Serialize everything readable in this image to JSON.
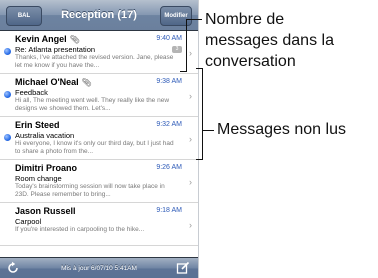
{
  "navbar": {
    "back_label": "BAL",
    "title": "Reception (17)",
    "edit_label": "Modifier"
  },
  "messages": [
    {
      "sender": "Kevin Angel",
      "has_attachment": true,
      "time": "9:40 AM",
      "subject": "Re: Atlanta presentation",
      "preview": "Thanks, I've attached the revised version. Jane, please let me know if you have the...",
      "unread": true,
      "count": "3"
    },
    {
      "sender": "Michael O'Neal",
      "has_attachment": true,
      "time": "9:38 AM",
      "subject": "Feedback",
      "preview": "Hi all, The meeting went well. They really like the new designs we showed them. Let's...",
      "unread": true,
      "count": ""
    },
    {
      "sender": "Erin Steed",
      "has_attachment": false,
      "time": "9:32 AM",
      "subject": "Australia vacation",
      "preview": "Hi everyone, I know it's only our third day, but I just had to share a photo from the...",
      "unread": true,
      "count": ""
    },
    {
      "sender": "Dimitri Proano",
      "has_attachment": false,
      "time": "9:26 AM",
      "subject": "Room change",
      "preview": "Today's brainstorming session will now take place in 23D. Please remember to bring...",
      "unread": false,
      "count": ""
    },
    {
      "sender": "Jason Russell",
      "has_attachment": false,
      "time": "9:18 AM",
      "subject": "Carpool",
      "preview": "If you're interested in carpooling to the hike...",
      "unread": false,
      "count": ""
    }
  ],
  "toolbar": {
    "updated_text": "Mis à jour 6/07/10 5:41AM"
  },
  "callouts": {
    "message_count": "Nombre de messages dans la conversation",
    "message_count_lines": [
      "Nombre de",
      "messages dans la",
      "conversation"
    ],
    "unread": "Messages non lus"
  },
  "colors": {
    "unread_dot": "#2a6ee8",
    "time": "#2e5bb8",
    "navbar": "#6d83a1"
  }
}
